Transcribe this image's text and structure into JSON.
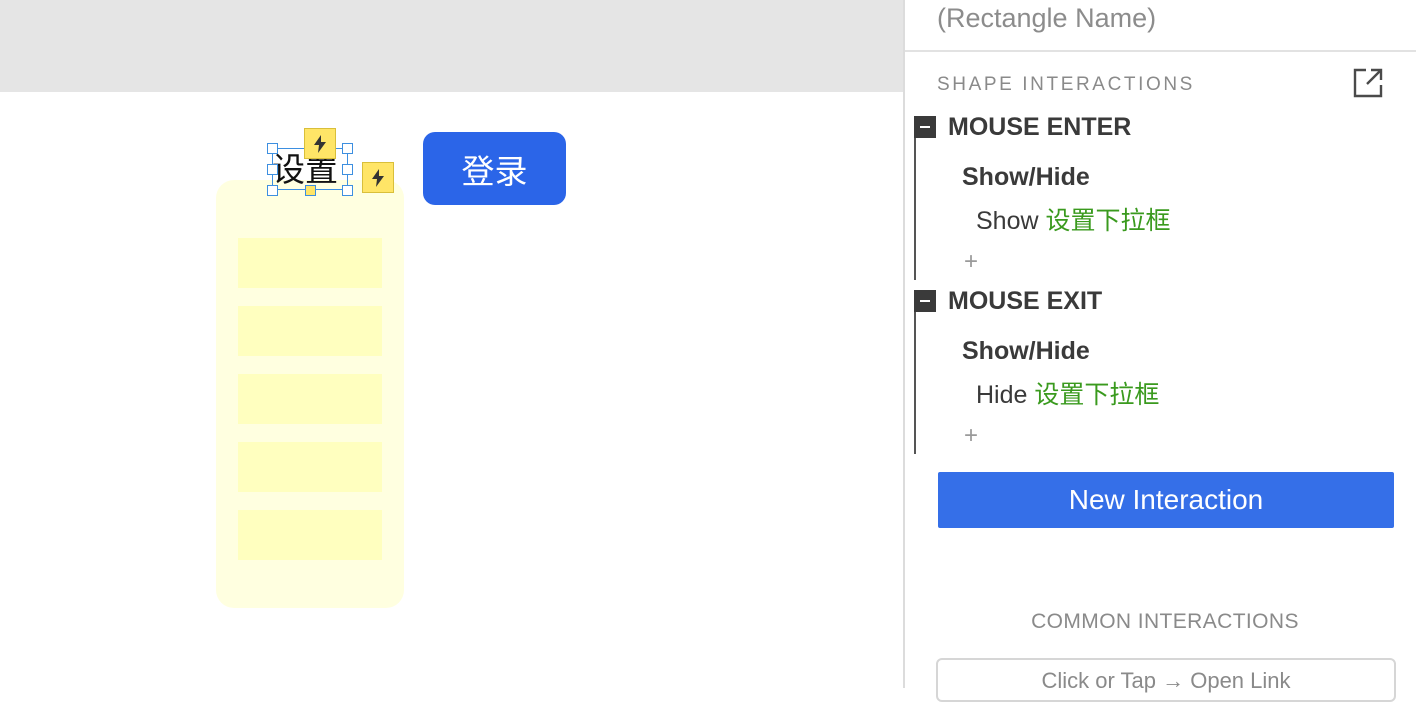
{
  "canvas": {
    "settings_label": "设置",
    "login_button": "登录",
    "dropdown_item_count": 5
  },
  "panel": {
    "name_placeholder": "(Rectangle Name)",
    "section_title": "SHAPE INTERACTIONS",
    "events": [
      {
        "title": "MOUSE ENTER",
        "action": "Show/Hide",
        "verb": "Show",
        "target": "设置下拉框",
        "add": "+"
      },
      {
        "title": "MOUSE EXIT",
        "action": "Show/Hide",
        "verb": "Hide",
        "target": "设置下拉框",
        "add": "+"
      }
    ],
    "new_interaction": "New Interaction",
    "common_title": "COMMON INTERACTIONS",
    "common_items": [
      "Click or Tap → Open Link"
    ]
  },
  "colors": {
    "accent_blue": "#356fe8",
    "login_blue": "#2b65e8",
    "target_green": "#3a9a1e",
    "dropdown_fill": "#ffffe0",
    "dropdown_item": "#ffffbf",
    "badge_yellow": "#ffe567",
    "selection_blue": "#3d8fe0"
  },
  "icons": [
    "lightning-icon",
    "popout-icon",
    "collapse-icon",
    "plus-icon"
  ]
}
